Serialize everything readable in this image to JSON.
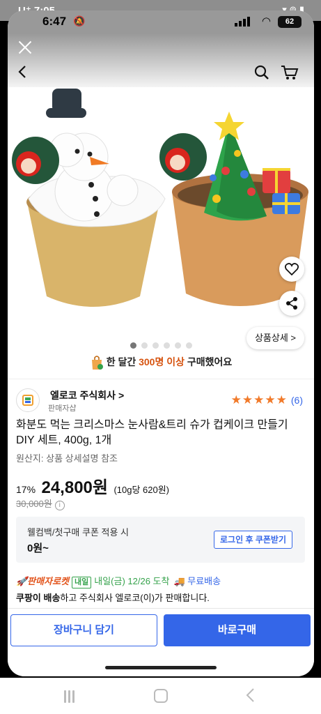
{
  "outer_status": {
    "left": "U⁺ 7:05",
    "right": "▾ ⊚ ▮"
  },
  "inner_status": {
    "time": "6:47",
    "battery": "62"
  },
  "hero": {
    "detail_button": "상품상세 >",
    "page_count": 6,
    "active_page": 1
  },
  "purchase_notice": {
    "prefix": "한 달간 ",
    "highlight": "300명 이상",
    "suffix": " 구매했어요"
  },
  "seller": {
    "name": "엘로코 주식회사 >",
    "sub": "판매자샵",
    "rating_stars": 5,
    "review_count": "(6)"
  },
  "product": {
    "title": "화분도 먹는 크리스마스 눈사람&트리 슈가 컵케이크 만들기 DIY 세트, 400g, 1개",
    "origin": "원산지: 상품 상세설명 참조",
    "discount": "17%",
    "price": "24,800원",
    "unit_price": "(10g당 620원)",
    "original_price": "30,000원",
    "info_icon": "i"
  },
  "coupon": {
    "label": "웰컴백/첫구매 쿠폰 적용 시",
    "amount": "0원~",
    "button": "로그인 후 쿠폰받기"
  },
  "delivery": {
    "rocket": "🚀판매자로켓",
    "tag": "내일",
    "when": "내일(금) 12/26 도착",
    "free": "🚚 무료배송",
    "line2_bold": "쿠팡이 배송",
    "line2_rest": "하고 주식회사 엘로코(이)가 판매합니다."
  },
  "actions": {
    "cart": "장바구니 담기",
    "buy": "바로구매"
  },
  "colors": {
    "accent": "#3466e8",
    "highlight": "#d6530f",
    "star": "#f17a2a",
    "green": "#35a24b"
  }
}
